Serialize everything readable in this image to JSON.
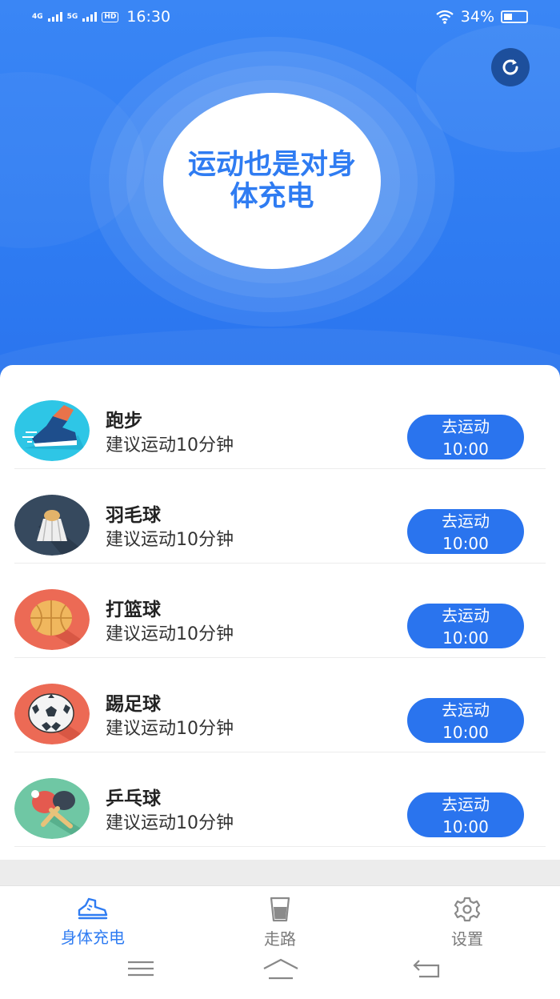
{
  "status_bar": {
    "network_1": "4G",
    "network_2": "5G",
    "hd": "HD",
    "time": "16:30",
    "battery": "34%"
  },
  "hero": {
    "slogan": "运动也是对身体充电"
  },
  "activities": [
    {
      "title": "跑步",
      "subtitle": "建议运动10分钟",
      "button_label": "去运动",
      "button_time": "10:00",
      "icon": "running-shoe-icon"
    },
    {
      "title": "羽毛球",
      "subtitle": "建议运动10分钟",
      "button_label": "去运动",
      "button_time": "10:00",
      "icon": "badminton-icon"
    },
    {
      "title": "打篮球",
      "subtitle": "建议运动10分钟",
      "button_label": "去运动",
      "button_time": "10:00",
      "icon": "basketball-icon"
    },
    {
      "title": "踢足球",
      "subtitle": "建议运动10分钟",
      "button_label": "去运动",
      "button_time": "10:00",
      "icon": "soccer-ball-icon"
    },
    {
      "title": "乒乓球",
      "subtitle": "建议运动10分钟",
      "button_label": "去运动",
      "button_time": "10:00",
      "icon": "ping-pong-icon"
    }
  ],
  "bottom_nav": {
    "items": [
      {
        "label": "身体充电",
        "icon": "sneaker-icon",
        "active": true
      },
      {
        "label": "走路",
        "icon": "cup-icon",
        "active": false
      },
      {
        "label": "设置",
        "icon": "gear-icon",
        "active": false
      }
    ]
  },
  "colors": {
    "primary": "#2f7cf2",
    "button": "#2a74ee",
    "inactive": "#7a7a7a"
  }
}
